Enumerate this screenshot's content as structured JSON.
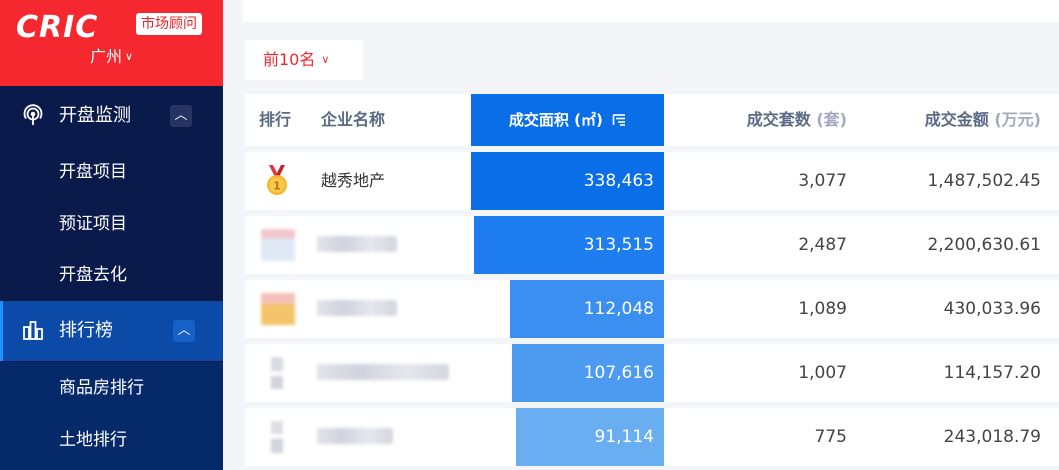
{
  "brand": {
    "logo_text": "CRIC",
    "tag": "市场顾问",
    "city": "广州"
  },
  "sidebar": {
    "groups": [
      {
        "label": "开盘监测",
        "icon": "broadcast-icon",
        "expanded": true,
        "items": [
          "开盘项目",
          "预证项目",
          "开盘去化"
        ]
      },
      {
        "label": "排行榜",
        "icon": "bar-chart-icon",
        "expanded": true,
        "active": true,
        "items": [
          "商品房排行",
          "土地排行"
        ]
      }
    ]
  },
  "filter": {
    "label": "前10名"
  },
  "table": {
    "headers": {
      "rank": "排行",
      "name": "企业名称",
      "area": "成交面积",
      "area_unit": "(㎡)",
      "count": "成交套数",
      "count_unit": "(套)",
      "amount": "成交金额",
      "amount_unit": "(万元)"
    },
    "rows": [
      {
        "rank": 1,
        "name": "越秀地产",
        "area": "338,463",
        "area_value": 338463,
        "count": "3,077",
        "amount": "1,487,502.45"
      },
      {
        "rank": 2,
        "name": "",
        "area": "313,515",
        "area_value": 313515,
        "count": "2,487",
        "amount": "2,200,630.61"
      },
      {
        "rank": 3,
        "name": "",
        "area": "112,048",
        "area_value": 112048,
        "count": "1,089",
        "amount": "430,033.96"
      },
      {
        "rank": 4,
        "name": "",
        "area": "107,616",
        "area_value": 107616,
        "count": "1,007",
        "amount": "114,157.20"
      },
      {
        "rank": 5,
        "name": "",
        "area": "91,114",
        "area_value": 91114,
        "count": "775",
        "amount": "243,018.79"
      }
    ]
  },
  "colors": {
    "brand_red": "#f5282f",
    "sidebar_bg": "#0a1a4a",
    "sidebar_active": "#0c4aa8",
    "sort_header": "#0a6ee8",
    "bar_colors": [
      "#0a6ee8",
      "#1e7ef0",
      "#3a8ff0",
      "#4d9bf0",
      "#6aaef2"
    ]
  }
}
